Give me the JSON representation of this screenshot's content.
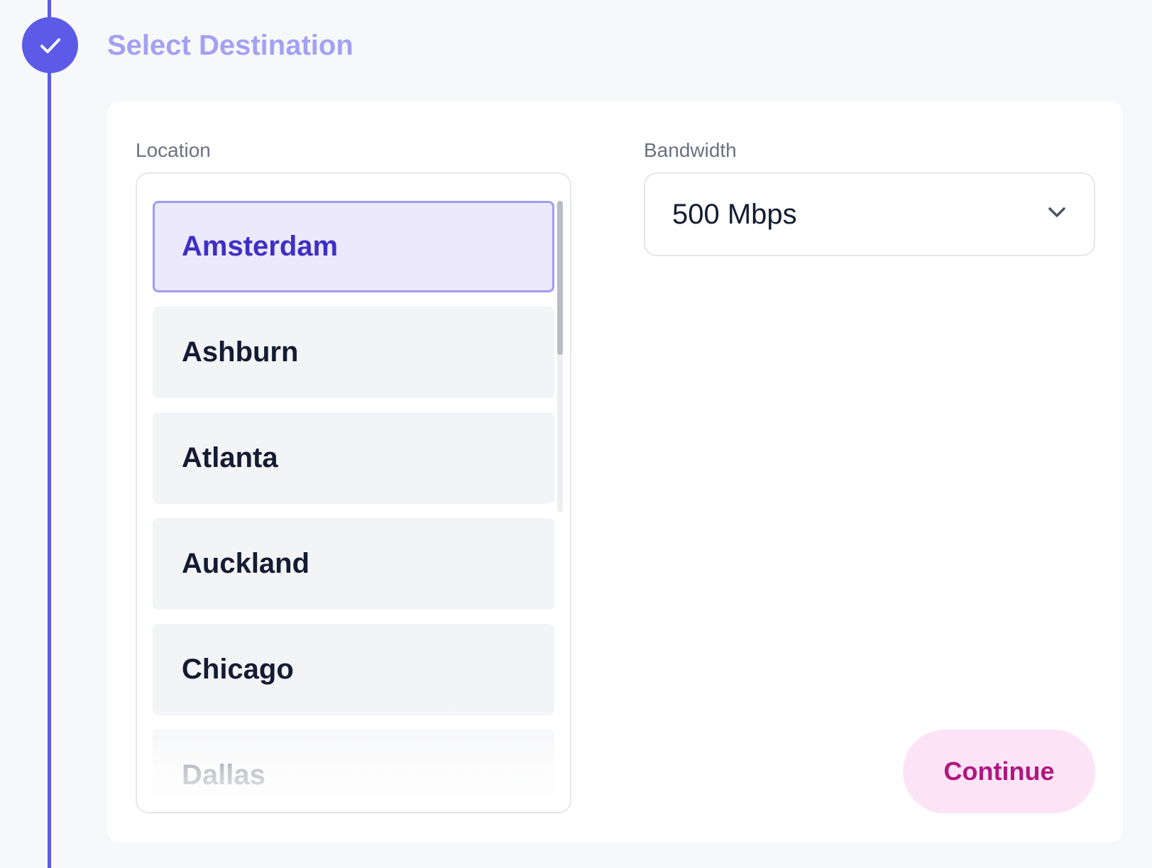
{
  "step": {
    "title": "Select Destination",
    "status": "completed",
    "status_icon": "check-icon",
    "accent_color": "#5b5be8"
  },
  "location": {
    "label": "Location",
    "items": [
      {
        "label": "Amsterdam",
        "selected": true
      },
      {
        "label": "Ashburn",
        "selected": false
      },
      {
        "label": "Atlanta",
        "selected": false
      },
      {
        "label": "Auckland",
        "selected": false
      },
      {
        "label": "Chicago",
        "selected": false
      },
      {
        "label": "Dallas",
        "selected": false
      }
    ],
    "selected_color": "#3f2fc4"
  },
  "bandwidth": {
    "label": "Bandwidth",
    "value": "500 Mbps",
    "icon": "chevron-down-icon"
  },
  "actions": {
    "continue_label": "Continue",
    "continue_color": "#b0177f",
    "continue_bg": "#fce4f6"
  }
}
